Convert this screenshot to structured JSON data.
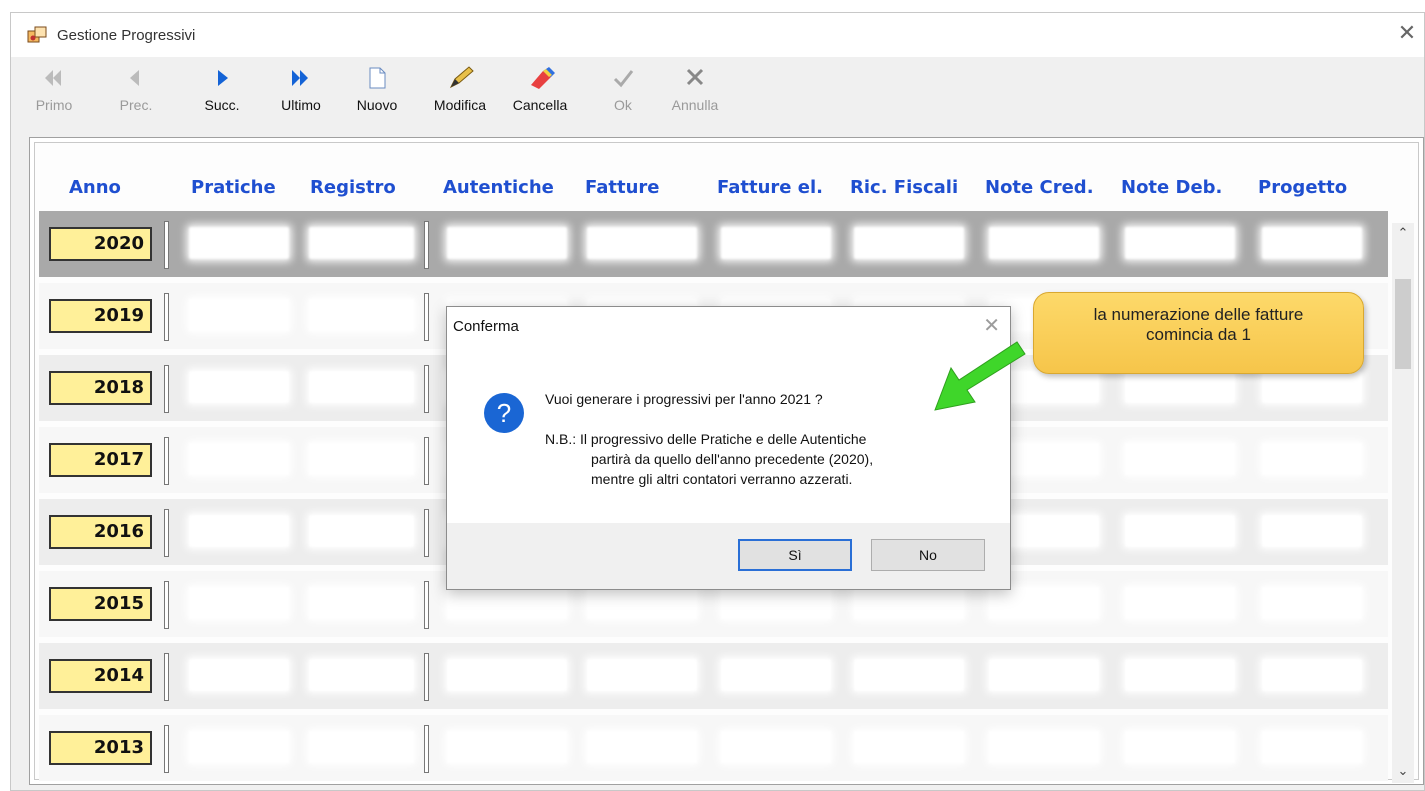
{
  "window": {
    "title": "Gestione Progressivi",
    "close": "✕"
  },
  "toolbar": {
    "buttons": [
      {
        "label": "Primo",
        "enabled": false
      },
      {
        "label": "Prec.",
        "enabled": false
      },
      {
        "label": "Succ.",
        "enabled": true
      },
      {
        "label": "Ultimo",
        "enabled": true
      },
      {
        "label": "Nuovo",
        "enabled": true
      },
      {
        "label": "Modifica",
        "enabled": true
      },
      {
        "label": "Cancella",
        "enabled": true
      },
      {
        "label": "Ok",
        "enabled": false
      },
      {
        "label": "Annulla",
        "enabled": false
      }
    ]
  },
  "grid": {
    "columns": [
      "Anno",
      "Pratiche",
      "Registro",
      "Autentiche",
      "Fatture",
      "Fatture el.",
      "Ric. Fiscali",
      "Note Cred.",
      "Note Deb.",
      "Progetto"
    ],
    "years": [
      "2020",
      "2019",
      "2018",
      "2017",
      "2016",
      "2015",
      "2014",
      "2013"
    ],
    "selected_year": "2020"
  },
  "dialog": {
    "title": "Conferma",
    "close": "✕",
    "icon": "?",
    "question": "Vuoi generare i progressivi per l'anno 2021 ?",
    "note_line1": "N.B.: Il progressivo delle Pratiche e delle Autentiche",
    "note_line2": "partirà da quello dell'anno precedente (2020),",
    "note_line3": "mentre gli altri contatori verranno azzerati.",
    "yes": "Sì",
    "no": "No"
  },
  "callout": {
    "line1": "la numerazione delle fatture",
    "line2": "comincia da 1"
  },
  "colors": {
    "header_blue": "#1f4fd0",
    "year_yellow": "#fff099",
    "callout": "#f6c54a",
    "arrow_green": "#3fd62a"
  }
}
